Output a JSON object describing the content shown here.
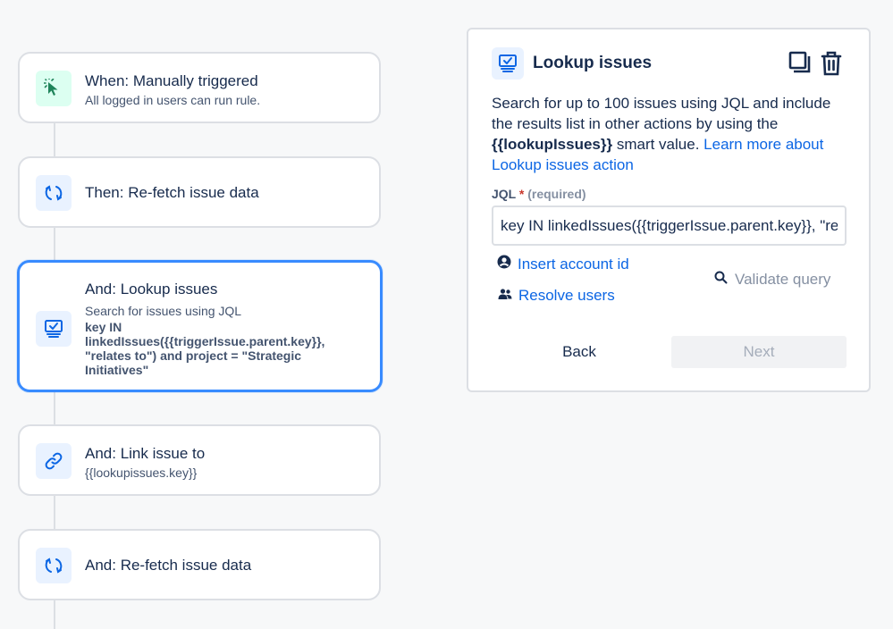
{
  "rules": [
    {
      "title": "When: Manually triggered",
      "subtitle": "All logged in users can run rule.",
      "icon": "cursor-click-icon"
    },
    {
      "title": "Then: Re-fetch issue data",
      "icon": "refresh-icon"
    },
    {
      "title": "And: Lookup issues",
      "subtitle": "Search for issues using JQL",
      "jql": "key IN linkedIssues({{triggerIssue.parent.key}}, \"relates to\") and project = \"Strategic Initiatives\"",
      "icon": "monitor-check-icon"
    },
    {
      "title": "And: Link issue to",
      "subtitle": "{{lookupissues.key}}",
      "icon": "link-icon"
    },
    {
      "title": "And: Re-fetch issue data",
      "icon": "refresh-icon"
    }
  ],
  "panel": {
    "title": "Lookup issues",
    "description_prefix": "Search for up to 100 issues using JQL and include the results list in other actions by using the ",
    "smart_value": "{{lookupIssues}}",
    "description_middle": " smart value. ",
    "learn_more": "Learn more about Lookup issues action",
    "jql_label": "JQL",
    "required_star": "*",
    "required_text": "(required)",
    "jql_value": "key IN linkedIssues({{triggerIssue.parent.key}}, \"relates to\") and project = \"Strategic Initiatives\"",
    "insert_account_id": "Insert account id",
    "resolve_users": "Resolve users",
    "validate_query": "Validate query",
    "back": "Back",
    "next": "Next"
  },
  "colors": {
    "accent": "#0c66e4",
    "selected_border": "#388bff",
    "trigger_green": "#1f845a",
    "action_blue": "#0c66e4"
  }
}
